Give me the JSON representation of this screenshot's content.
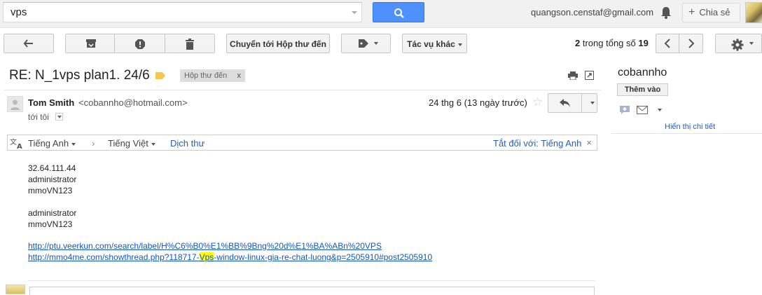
{
  "search": {
    "query": "vps"
  },
  "account": {
    "email": "quangson.censtaf@gmail.com",
    "share_label": "Chia sẻ"
  },
  "toolbar": {
    "move_to_inbox": "Chuyển tới Hộp thư đến",
    "more_actions": "Tác vụ khác",
    "pager_current": "2",
    "pager_text": "trong tổng số",
    "pager_total": "19"
  },
  "message": {
    "subject": "RE: N_1vps plan1. 24/6",
    "label_chip": "Hộp thư đến",
    "label_chip_close": "x",
    "sender_name": "Tom Smith",
    "sender_email": "<cobannho@hotmail.com>",
    "to_me": "tới tôi",
    "date": "24 thg 6 (13 ngày trước)"
  },
  "translate": {
    "source_lang": "Tiếng Anh",
    "target_lang": "Tiếng Việt",
    "translate_link": "Dịch thư",
    "turn_off": "Tắt đối với: Tiếng Anh",
    "close": "×"
  },
  "body": {
    "lines": [
      "32.64.111.44",
      "administrator",
      "mmoVN123",
      "",
      "administrator",
      "mmoVN123"
    ],
    "link1": "http://ptu.veerkun.com/search/label/H%C6%B0%E1%BB%9Bng%20d%E1%BA%ABn%20VPS",
    "link2_pre": "http://mmo4me.com/showthread.php?118717-",
    "link2_hl": "Vps",
    "link2_post": "-window-linux-gia-re-chat-luong&p=2505910#post2505910"
  },
  "side": {
    "contact_name": "cobannho",
    "add_button": "Thêm vào",
    "details_link": "Hiển thị chi tiết"
  },
  "colors": {
    "accent": "#4d90fe",
    "link": "#1155cc",
    "label_tag": "#f2c94c"
  }
}
